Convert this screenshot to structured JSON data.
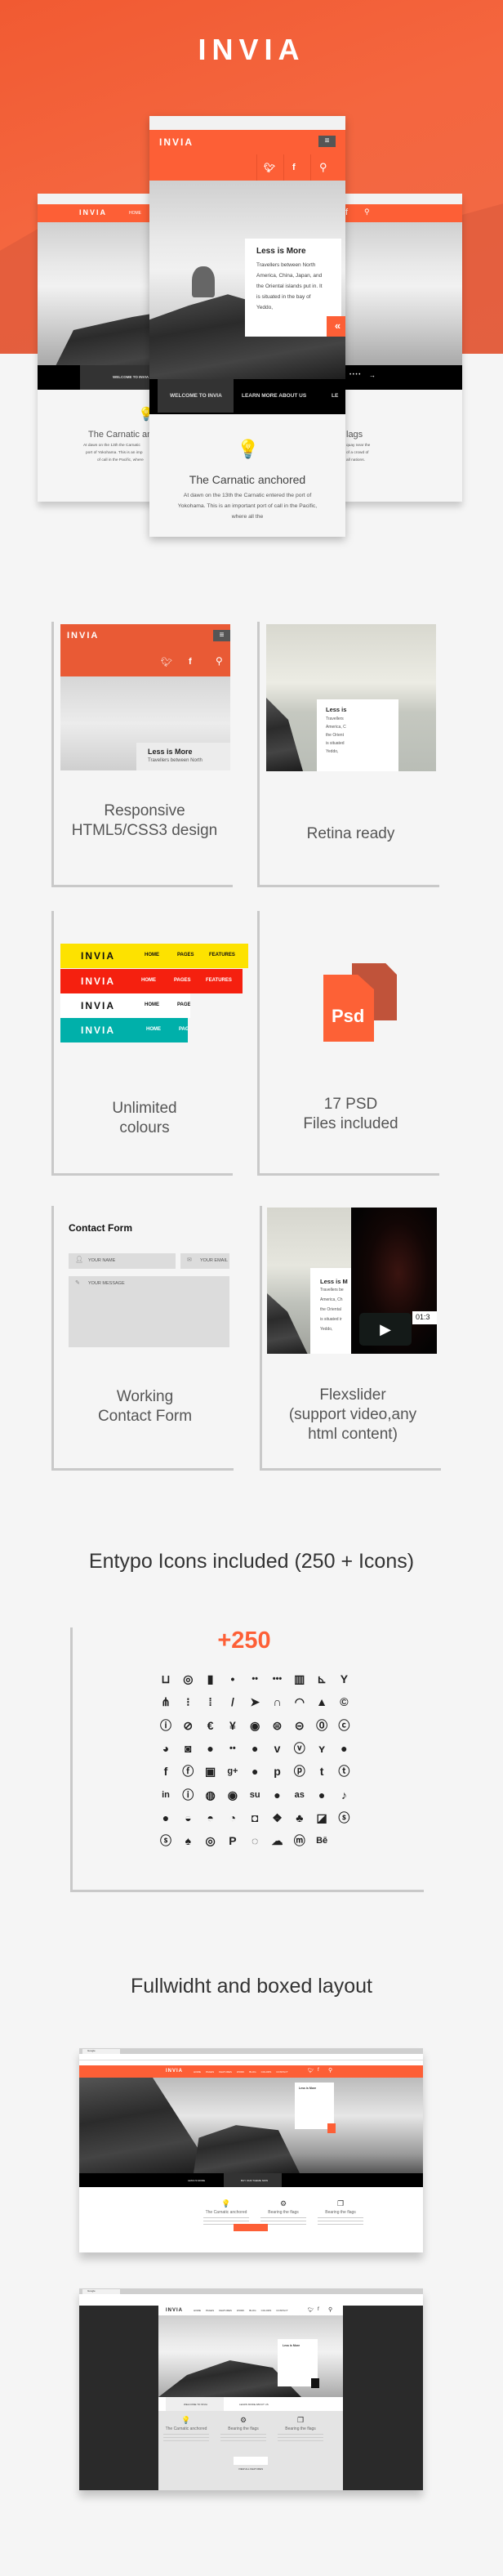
{
  "brand": "INVIA",
  "colors": {
    "accent": "#fd5f36",
    "yellow": "#fde200",
    "red": "#f5200f",
    "white": "#ffffff",
    "teal": "#00b0aa",
    "dark": "#2a2a2a"
  },
  "hero": {
    "title": "INVIA",
    "phone": {
      "logo": "INVIA",
      "menu_icon": "hamburger-icon",
      "social": [
        "twitter-icon",
        "facebook-icon",
        "search-icon"
      ],
      "caption": {
        "title": "Less is More",
        "lines": [
          "Travellers between North",
          "America, China, Japan, and",
          "the Oriental islands put in. It",
          "is situated in the bay of",
          "Yeddo,"
        ]
      },
      "nav": [
        "WELCOME TO INVIA",
        "LEARN MORE ABOUT US",
        "LE"
      ],
      "feature": {
        "icon": "lightbulb-icon",
        "title": "The Carnatic anchored",
        "lines": [
          "At dawn on the 13th the Carnatic entered the port of",
          "Yokohama. This is an important port of call in the Pacific,",
          "where all the"
        ]
      }
    },
    "left_screen": {
      "logo": "INVIA",
      "nav": "HOME",
      "slide_nav": "WELCOME TO INVIA",
      "title": "The Carnatic anch",
      "lines": [
        "At dawn on the 13th the Carnatic",
        "port of Yokohama. This is an imp",
        "of call in the Pacific, where"
      ]
    },
    "right_screen": {
      "title": "lags",
      "lines": [
        "quay near the",
        "of a crowd of",
        "all nations."
      ]
    }
  },
  "features": [
    {
      "label_1": "Responsive",
      "label_2": "HTML5/CSS3 design",
      "preview": {
        "logo": "INVIA",
        "caption_title": "Less is More",
        "caption_line": "Travellers between North"
      }
    },
    {
      "label_1": "Retina ready",
      "preview": {
        "caption_title": "Less is",
        "lines": [
          "Travellers",
          "America, C",
          "the Orient",
          "is situated",
          "Yeddo,"
        ]
      }
    },
    {
      "label_1": "Unlimited",
      "label_2": "colours",
      "bars": [
        {
          "logo": "INVIA",
          "items": [
            "HOME",
            "PAGES",
            "FEATURES"
          ]
        },
        {
          "logo": "INVIA",
          "items": [
            "HOME",
            "PAGES",
            "FEATURES"
          ]
        },
        {
          "logo": "INVIA",
          "items": [
            "HOME",
            "PAGE"
          ]
        },
        {
          "logo": "INVIA",
          "items": [
            "HOME",
            "PAG"
          ]
        }
      ]
    },
    {
      "label_1": "17 PSD",
      "label_2": "Files included",
      "icon_text": "Psd"
    },
    {
      "label_1": "Working",
      "label_2": "Contact Form",
      "form": {
        "title": "Contact Form",
        "name_placeholder": "YOUR NAME",
        "email_placeholder": "YOUR EMAIL",
        "message_placeholder": "YOUR MESSAGE"
      }
    },
    {
      "label_1": "Flexslider",
      "label_2": "(support video,any",
      "label_3": "html content)",
      "preview": {
        "caption_title": "Less is M",
        "lines": [
          "Travellers be",
          "America, Ch",
          "the Oriental",
          "is situated ir",
          "Yeddo,"
        ],
        "video_time": "01:3"
      }
    }
  ],
  "icons_section": {
    "title": "Entypo Icons included (250 + Icons)",
    "count": "+250",
    "icons": [
      {
        "name": "inbox-icon",
        "glyph": "⊔"
      },
      {
        "name": "lifebuoy-icon",
        "glyph": "◎"
      },
      {
        "name": "mouse-icon",
        "glyph": "▮"
      },
      {
        "name": "dot-icon",
        "glyph": "•"
      },
      {
        "name": "two-dots-icon",
        "glyph": "••"
      },
      {
        "name": "three-dots-icon",
        "glyph": "•••"
      },
      {
        "name": "suitcase-icon",
        "glyph": "▥"
      },
      {
        "name": "flow-cascade-icon",
        "glyph": "⊾"
      },
      {
        "name": "flow-branch-icon",
        "glyph": "Y"
      },
      {
        "name": "flow-tree-icon",
        "glyph": "⋔"
      },
      {
        "name": "flow-line-icon",
        "glyph": "⁝"
      },
      {
        "name": "flow-parallel-icon",
        "glyph": "⁞"
      },
      {
        "name": "brush-icon",
        "glyph": "/"
      },
      {
        "name": "paper-plane-icon",
        "glyph": "➤"
      },
      {
        "name": "magnet-icon",
        "glyph": "∩"
      },
      {
        "name": "gauge-icon",
        "glyph": "◠"
      },
      {
        "name": "traffic-cone-icon",
        "glyph": "▲"
      },
      {
        "name": "cc-icon",
        "glyph": "©"
      },
      {
        "name": "cc-by-icon",
        "glyph": "ⓘ"
      },
      {
        "name": "cc-nc-icon",
        "glyph": "⊘"
      },
      {
        "name": "cc-nc-eu-icon",
        "glyph": "€"
      },
      {
        "name": "cc-nc-jp-icon",
        "glyph": "¥"
      },
      {
        "name": "cc-sa-icon",
        "glyph": "◉"
      },
      {
        "name": "cc-nd-icon",
        "glyph": "⊜"
      },
      {
        "name": "cc-pd-icon",
        "glyph": "⊝"
      },
      {
        "name": "cc-zero-icon",
        "glyph": "⓪"
      },
      {
        "name": "cc-share-icon",
        "glyph": "ⓒ"
      },
      {
        "name": "cc-remix-icon",
        "glyph": "◕"
      },
      {
        "name": "github-icon",
        "glyph": "◙"
      },
      {
        "name": "github-circled-icon",
        "glyph": "●"
      },
      {
        "name": "flickr-icon",
        "glyph": "••"
      },
      {
        "name": "flickr-circled-icon",
        "glyph": "●"
      },
      {
        "name": "vimeo-icon",
        "glyph": "v"
      },
      {
        "name": "vimeo-circled-icon",
        "glyph": "ⓥ"
      },
      {
        "name": "twitter-icon",
        "glyph": "ʏ"
      },
      {
        "name": "twitter-circled-icon",
        "glyph": "●"
      },
      {
        "name": "facebook-icon",
        "glyph": "f"
      },
      {
        "name": "facebook-circled-icon",
        "glyph": "ⓕ"
      },
      {
        "name": "facebook-squared-icon",
        "glyph": "▣"
      },
      {
        "name": "gplus-icon",
        "glyph": "g+"
      },
      {
        "name": "gplus-circled-icon",
        "glyph": "●"
      },
      {
        "name": "pinterest-icon",
        "glyph": "p"
      },
      {
        "name": "pinterest-circled-icon",
        "glyph": "ⓟ"
      },
      {
        "name": "tumblr-icon",
        "glyph": "t"
      },
      {
        "name": "tumblr-circled-icon",
        "glyph": "ⓣ"
      },
      {
        "name": "linkedin-icon",
        "glyph": "in"
      },
      {
        "name": "linkedin-circled-icon",
        "glyph": "ⓘ"
      },
      {
        "name": "dribbble-icon",
        "glyph": "◍"
      },
      {
        "name": "dribbble-circled-icon",
        "glyph": "◉"
      },
      {
        "name": "stumbleupon-icon",
        "glyph": "su"
      },
      {
        "name": "stumbleupon-circled-icon",
        "glyph": "●"
      },
      {
        "name": "lastfm-icon",
        "glyph": "as"
      },
      {
        "name": "lastfm-circled-icon",
        "glyph": "●"
      },
      {
        "name": "rdio-icon",
        "glyph": "♪"
      },
      {
        "name": "rdio-circled-icon",
        "glyph": "●"
      },
      {
        "name": "spotify-icon",
        "glyph": "◒"
      },
      {
        "name": "spotify-circled-icon",
        "glyph": "◓"
      },
      {
        "name": "qq-icon",
        "glyph": "◔"
      },
      {
        "name": "instagram-icon",
        "glyph": "◘"
      },
      {
        "name": "dropbox-icon",
        "glyph": "❖"
      },
      {
        "name": "evernote-icon",
        "glyph": "♣"
      },
      {
        "name": "flattr-icon",
        "glyph": "◪"
      },
      {
        "name": "skype-icon",
        "glyph": "ⓢ"
      },
      {
        "name": "skype-circled-icon",
        "glyph": "ⓢ"
      },
      {
        "name": "renren-icon",
        "glyph": "♠"
      },
      {
        "name": "sina-weibo-icon",
        "glyph": "◎"
      },
      {
        "name": "paypal-icon",
        "glyph": "P"
      },
      {
        "name": "picasa-icon",
        "glyph": "◌"
      },
      {
        "name": "soundcloud-icon",
        "glyph": "☁"
      },
      {
        "name": "mixi-icon",
        "glyph": "ⓜ"
      },
      {
        "name": "behance-icon",
        "glyph": "Bē"
      }
    ]
  },
  "layouts_section": {
    "title": "Fullwidht and boxed layout",
    "browser_tab": "Google",
    "nav": [
      "HOME",
      "PAGES",
      "FEATURES",
      "WORK",
      "BLOG",
      "COLORS",
      "CONTACT"
    ],
    "fullwidth": {
      "slide_nav": [
        "LESS IS MORE",
        "BUY OUR THEME NOW"
      ],
      "button": "VIEW ALL FEATURES"
    },
    "boxed": {
      "slide_nav": [
        "WELCOME TO INVIA",
        "LEARN MORE ABOUT US"
      ],
      "button": "VIEW ALL FEATURES"
    },
    "caption_title": "Less is More",
    "features": [
      {
        "icon": "lightbulb-icon",
        "title": "The Carnatic anchored"
      },
      {
        "icon": "gear-icon",
        "title": "Bearing the flags"
      },
      {
        "icon": "chat-icon",
        "title": "Bearing the flags"
      }
    ]
  }
}
